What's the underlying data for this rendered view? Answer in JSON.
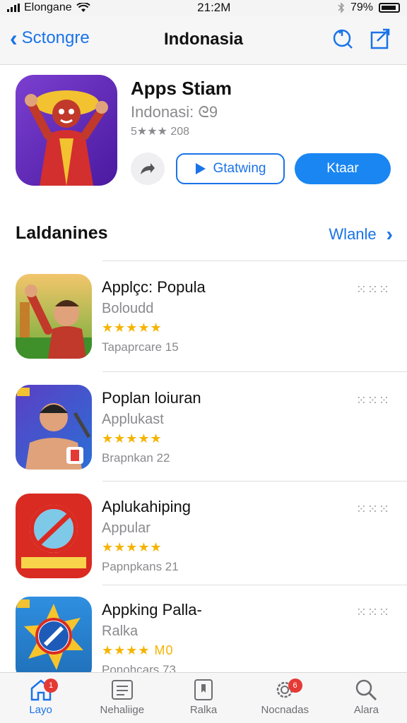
{
  "status_bar": {
    "carrier": "Elongane",
    "time": "21:2M",
    "battery": "79%"
  },
  "nav": {
    "back_label": "Sctongre",
    "title": "Indonasia"
  },
  "featured": {
    "name": "Apps Stiam",
    "subtitle": "Indonasi: ᘓ9",
    "rating_text": "5★★★ 208",
    "get_label": "Gtatwing",
    "open_label": "Ktaar"
  },
  "section": {
    "title": "Laldanines",
    "link_label": "Wlanle",
    "link_chevron": "›"
  },
  "apps": [
    {
      "name": "Applçc: Popula",
      "category": "Boloudd",
      "stars": "★★★★★",
      "count": "Tapaprcare 15",
      "more": "⁙⁙⁙"
    },
    {
      "name": "Poplan loiuran",
      "category": "Applukast",
      "stars": "★★★★★",
      "count": "Brapnkan 22",
      "more": "⁙⁙⁙"
    },
    {
      "name": "Aplukahiping",
      "category": "Appular",
      "stars": "★★★★★",
      "count": "Papnpkans 21",
      "more": "⁙⁙⁙"
    },
    {
      "name": "Appking Palla-",
      "category": "Ralka",
      "stars": "★★★★ M0",
      "count": "Ponohcars 73",
      "more": "⁙⁙⁙"
    }
  ],
  "tabs": [
    {
      "label": "Layo",
      "icon": "home-icon",
      "badge": "1"
    },
    {
      "label": "Nehaliige",
      "icon": "list-icon",
      "badge": ""
    },
    {
      "label": "Ralka",
      "icon": "bookmark-icon",
      "badge": ""
    },
    {
      "label": "Nocnadas",
      "icon": "gear-icon",
      "badge": "6"
    },
    {
      "label": "Alara",
      "icon": "search-icon",
      "badge": ""
    }
  ],
  "colors": {
    "accent": "#1a73e8",
    "star": "#f5b400",
    "badge": "#e53935"
  }
}
